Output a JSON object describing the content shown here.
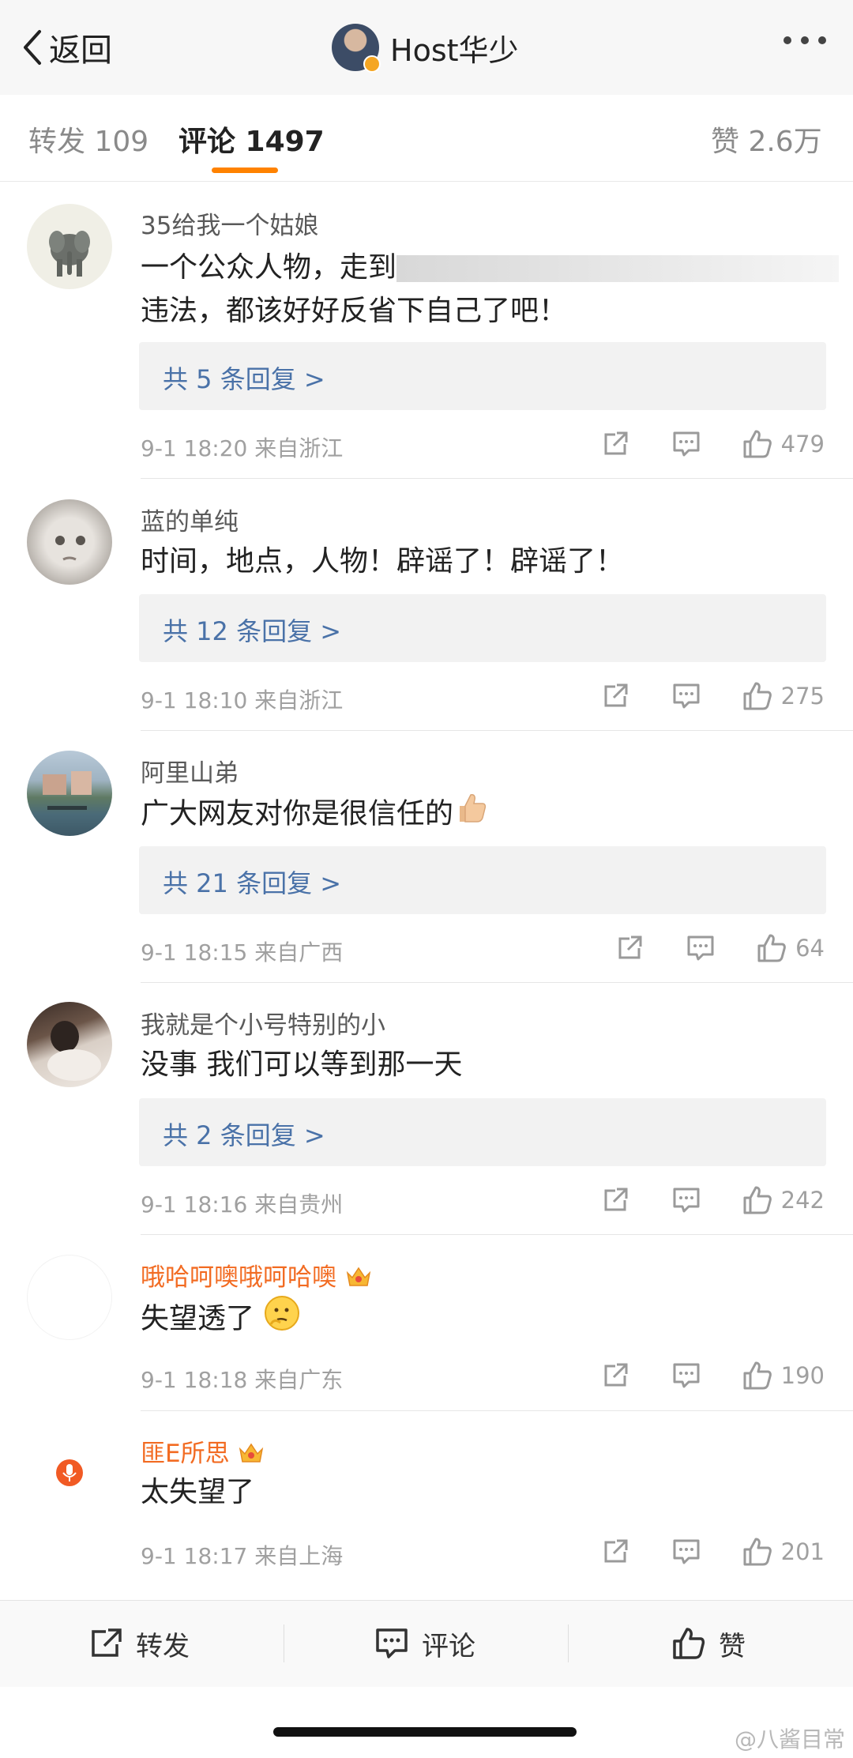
{
  "nav": {
    "back_label": "返回",
    "title": "Host华少"
  },
  "tabs": {
    "repost": "转发 109",
    "comment": "评论 1497",
    "like": "赞 2.6万"
  },
  "accent_color": "#ff8200",
  "comments": [
    {
      "name": "35给我一个姑娘",
      "line1": "一个公众人物，走到",
      "line2": "违法，都该好好反省下自己了吧！",
      "replies": "共 5 条回复 >",
      "meta": "9-1 18:20  来自浙江",
      "likes": "479",
      "avatar_icon": "elephant-avatar"
    },
    {
      "name": "蓝的单纯",
      "line1": "时间，地点，人物！辟谣了！辟谣了！",
      "replies": "共 12 条回复 >",
      "meta": "9-1 18:10  来自浙江",
      "likes": "275",
      "avatar_icon": "baby-face-avatar"
    },
    {
      "name": "阿里山弟",
      "line1": "广大网友对你是很信任的",
      "replies": "共 21 条回复 >",
      "meta": "9-1 18:15  来自广西",
      "likes": "64",
      "avatar_icon": "river-scene-avatar"
    },
    {
      "name": "我就是个小号特别的小",
      "line1": "没事 我们可以等到那一天",
      "replies": "共 2 条回复 >",
      "meta": "9-1 18:16  来自贵州",
      "likes": "242",
      "avatar_icon": "person-photo-avatar"
    },
    {
      "name": "哦哈呵噢哦呵哈噢",
      "line1": "失望透了",
      "meta": "9-1 18:18  来自广东",
      "likes": "190",
      "avatar_icon": "blank-avatar"
    },
    {
      "name": "匪E所思",
      "line1": "太失望了",
      "meta": "9-1 18:17  来自上海",
      "likes": "201",
      "avatar_icon": "microphone-avatar"
    }
  ],
  "bottom": {
    "repost": "转发",
    "comment": "评论",
    "like": "赞"
  },
  "watermark": "@八酱目常"
}
